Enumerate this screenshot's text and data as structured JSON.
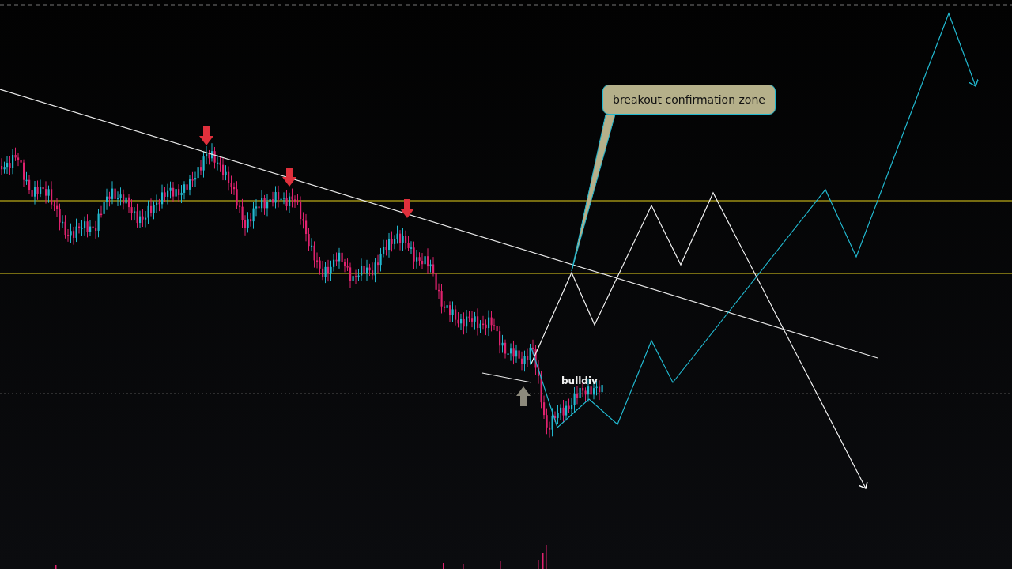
{
  "callout": {
    "text": "breakout confirmation zone"
  },
  "label": {
    "text": "bulldiv"
  }
}
